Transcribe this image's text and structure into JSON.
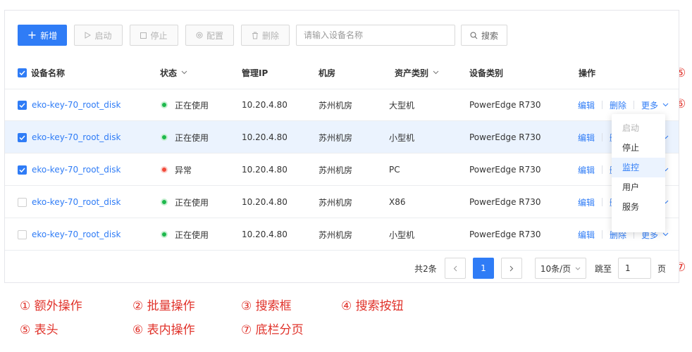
{
  "markers": [
    "①",
    "②",
    "③",
    "④",
    "⑤",
    "⑥",
    "⑦"
  ],
  "toolbar": {
    "add_label": "新增",
    "start_label": "启动",
    "stop_label": "停止",
    "config_label": "配置",
    "delete_label": "删除",
    "search_placeholder": "请输入设备名称",
    "search_label": "搜索"
  },
  "table": {
    "headers": {
      "name": "设备名称",
      "status": "状态",
      "ip": "管理IP",
      "room": "机房",
      "asset": "资产类别",
      "type": "设备类别",
      "ops": "操作"
    },
    "rows": [
      {
        "checked": true,
        "name": "eko-key-70_root_disk",
        "status": "正在使用",
        "status_kind": "ok",
        "ip": "10.20.4.80",
        "room": "苏州机房",
        "asset": "大型机",
        "type": "PowerEdge R730"
      },
      {
        "checked": true,
        "name": "eko-key-70_root_disk",
        "status": "正在使用",
        "status_kind": "ok",
        "ip": "10.20.4.80",
        "room": "苏州机房",
        "asset": "小型机",
        "type": "PowerEdge R730"
      },
      {
        "checked": true,
        "name": "eko-key-70_root_disk",
        "status": "异常",
        "status_kind": "err",
        "ip": "10.20.4.80",
        "room": "苏州机房",
        "asset": "PC",
        "type": "PowerEdge R730"
      },
      {
        "checked": false,
        "name": "eko-key-70_root_disk",
        "status": "正在使用",
        "status_kind": "ok",
        "ip": "10.20.4.80",
        "room": "苏州机房",
        "asset": "X86",
        "type": "PowerEdge R730"
      },
      {
        "checked": false,
        "name": "eko-key-70_root_disk",
        "status": "正在使用",
        "status_kind": "ok",
        "ip": "10.20.4.80",
        "room": "苏州机房",
        "asset": "小型机",
        "type": "PowerEdge R730"
      }
    ],
    "row_actions": {
      "edit": "编辑",
      "delete": "删除",
      "more": "更多"
    }
  },
  "dropdown": {
    "items": [
      {
        "label": "启动",
        "state": "disabled"
      },
      {
        "label": "停止",
        "state": "normal"
      },
      {
        "label": "监控",
        "state": "active"
      },
      {
        "label": "用户",
        "state": "normal"
      },
      {
        "label": "服务",
        "state": "normal"
      }
    ]
  },
  "pagination": {
    "total": "共2条",
    "current_page": "1",
    "page_size": "10条/页",
    "jump_label": "跳至",
    "jump_value": "1",
    "page_suffix": "页"
  },
  "legend": [
    "① 额外操作",
    "② 批量操作",
    "③ 搜索框",
    "④ 搜索按钮",
    "⑤ 表头",
    "⑥ 表内操作",
    "⑦ 底栏分页"
  ],
  "colors": {
    "primary": "#2f7cf6",
    "annotation": "#e0322a",
    "ok": "#1db84c",
    "error": "#f24a3a",
    "row_highlight": "#ebf3fe"
  }
}
